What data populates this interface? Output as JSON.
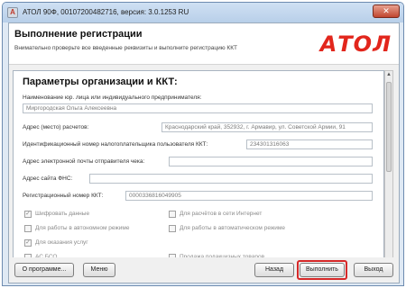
{
  "window": {
    "title": "АТОЛ 90Ф, 00107200482716, версия: 3.0.1253 RU",
    "close_glyph": "✕"
  },
  "header": {
    "title": "Выполнение регистрации",
    "subtitle": "Внимательно проверьте все введенные реквизиты и выполните регистрацию ККТ",
    "logo_text": "АТОЛ",
    "logo_color": "#e2261c"
  },
  "section": {
    "title": "Параметры организации и ККТ:"
  },
  "fields": {
    "org_name_label": "Наименование юр. лица или индивидуального предпринимателя:",
    "org_name_value": "Миргородская Ольга Алексеевна",
    "address_label": "Адрес (место) расчетов:",
    "address_value": "Краснодарский край, 352932, г. Армавир, ул. Советской Армии, 91",
    "inn_label": "Идентификационный номер налогоплательщика пользователя ККТ:",
    "inn_value": "234301316063",
    "email_label": "Адрес электронной почты отправителя чека:",
    "email_value": "",
    "fns_site_label": "Адрес сайта ФНС:",
    "fns_site_value": "",
    "reg_number_label": "Регистрационный номер ККТ:",
    "reg_number_value": "0000336816049905"
  },
  "checkboxes": [
    {
      "label": "Шифровать данные",
      "checked": true
    },
    {
      "label": "Для расчётов в сети Интернет",
      "checked": false
    },
    {
      "label": "Для работы в автономном режиме",
      "checked": false
    },
    {
      "label": "Для работы в автоматическом режиме",
      "checked": false
    },
    {
      "label": "Для оказания услуг",
      "checked": true
    },
    {
      "label": "АС БСО",
      "checked": false
    },
    {
      "label": "Продажа подакцизных товаров",
      "checked": false
    }
  ],
  "footer": {
    "about_label": "О программе...",
    "menu_label": "Меню",
    "back_label": "Назад",
    "execute_label": "Выполнить",
    "exit_label": "Выход",
    "highlight_color": "#d62828"
  },
  "icons": {
    "checked_glyph": "✓",
    "scroll_up_glyph": "▲",
    "scroll_down_glyph": "▼"
  }
}
